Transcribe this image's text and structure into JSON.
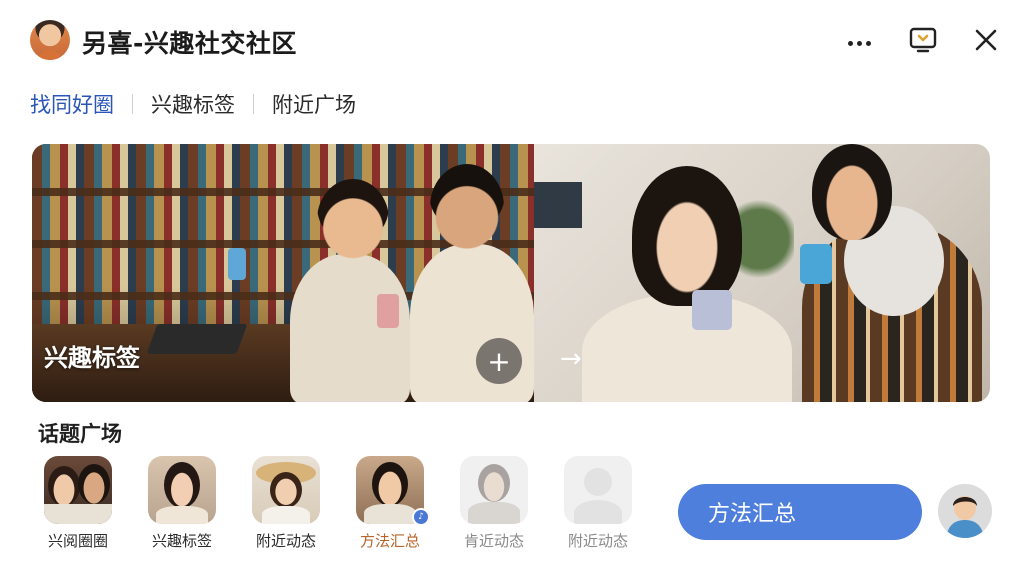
{
  "app": {
    "title": "另喜-兴趣社交社区"
  },
  "nav": {
    "tabs": [
      "找同好圈",
      "兴趣标签",
      "附近广场"
    ],
    "active_index": 0
  },
  "hero": {
    "label": "兴趣标签",
    "plus_symbol": "+",
    "arrow_symbol": "→"
  },
  "topics": {
    "title": "话题广场",
    "items": [
      {
        "label": "兴阅圈圈",
        "state": "normal"
      },
      {
        "label": "兴趣标签",
        "state": "normal"
      },
      {
        "label": "附近动态",
        "state": "normal"
      },
      {
        "label": "方法汇总",
        "state": "highlight"
      },
      {
        "label": "肯近动态",
        "state": "faded"
      },
      {
        "label": "附近动态",
        "state": "faded"
      }
    ]
  },
  "cta": {
    "label": "方法汇总"
  },
  "colors": {
    "accent_blue": "#2b56b8",
    "cta_blue": "#4f7fdc",
    "highlight_orange": "#b8642a",
    "faded_gray": "#8a8a8a"
  },
  "icons": [
    "more-icon",
    "screen-icon",
    "close-icon",
    "plus-icon",
    "arrow-right-icon",
    "avatar"
  ]
}
